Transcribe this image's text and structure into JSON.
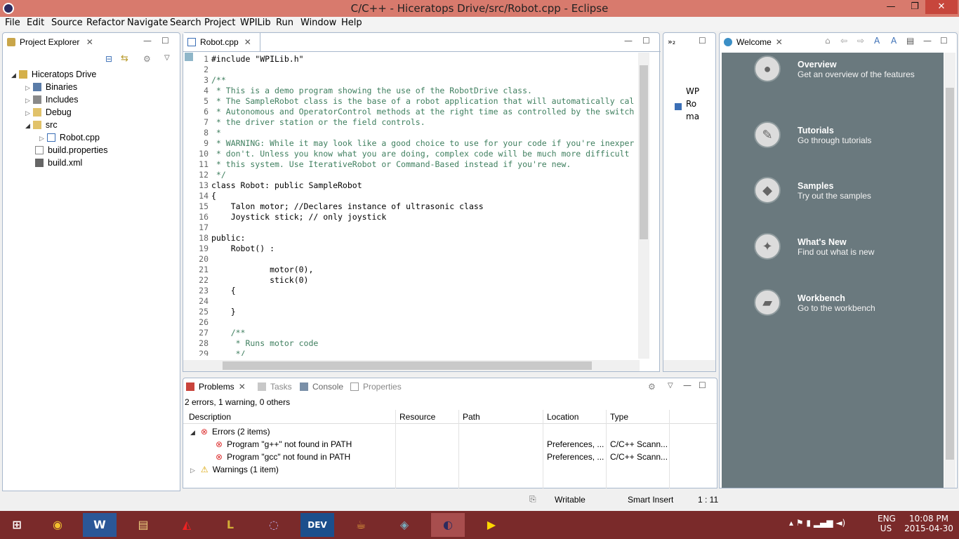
{
  "window": {
    "title": "C/C++ - Hiceratops Drive/src/Robot.cpp - Eclipse",
    "min": "—",
    "max": "❐",
    "close": "✕"
  },
  "menu": [
    "File",
    "Edit",
    "Source",
    "Refactor",
    "Navigate",
    "Search",
    "Project",
    "WPILib",
    "Run",
    "Window",
    "Help"
  ],
  "project_explorer": {
    "tab": "Project Explorer",
    "items": [
      "Hiceratops Drive",
      "Binaries",
      "Includes",
      "Debug",
      "src",
      "Robot.cpp",
      "build.properties",
      "build.xml"
    ]
  },
  "editor": {
    "tab": "Robot.cpp",
    "lines": [
      {
        "n": "1",
        "t": "#include \"WPILib.h\""
      },
      {
        "n": "2",
        "t": ""
      },
      {
        "n": "3",
        "t": "/**"
      },
      {
        "n": "4",
        "t": " * This is a demo program showing the use of the RobotDrive class."
      },
      {
        "n": "5",
        "t": " * The SampleRobot class is the base of a robot application that will automatically cal"
      },
      {
        "n": "6",
        "t": " * Autonomous and OperatorControl methods at the right time as controlled by the switch"
      },
      {
        "n": "7",
        "t": " * the driver station or the field controls."
      },
      {
        "n": "8",
        "t": " *"
      },
      {
        "n": "9",
        "t": " * WARNING: While it may look like a good choice to use for your code if you're inexper"
      },
      {
        "n": "10",
        "t": " * don't. Unless you know what you are doing, complex code will be much more difficult"
      },
      {
        "n": "11",
        "t": " * this system. Use IterativeRobot or Command-Based instead if you're new."
      },
      {
        "n": "12",
        "t": " */"
      },
      {
        "n": "13",
        "t": "class Robot: public SampleRobot"
      },
      {
        "n": "14",
        "t": "{"
      },
      {
        "n": "15",
        "t": "    Talon motor; //Declares instance of ultrasonic class"
      },
      {
        "n": "16",
        "t": "    Joystick stick; // only joystick"
      },
      {
        "n": "17",
        "t": ""
      },
      {
        "n": "18",
        "t": "public:"
      },
      {
        "n": "19",
        "t": "    Robot() :"
      },
      {
        "n": "20",
        "t": ""
      },
      {
        "n": "21",
        "t": "            motor(0),"
      },
      {
        "n": "22",
        "t": "            stick(0)"
      },
      {
        "n": "23",
        "t": "    {"
      },
      {
        "n": "24",
        "t": ""
      },
      {
        "n": "25",
        "t": "    }"
      },
      {
        "n": "26",
        "t": ""
      },
      {
        "n": "27",
        "t": "    /**"
      },
      {
        "n": "28",
        "t": "     * Runs motor code"
      },
      {
        "n": "29",
        "t": "     */"
      }
    ]
  },
  "outline": {
    "items": [
      "WP",
      "Ro",
      "ma"
    ]
  },
  "welcome": {
    "tab": "Welcome",
    "items": [
      {
        "title": "Overview",
        "desc": "Get an overview of the features"
      },
      {
        "title": "Tutorials",
        "desc": "Go through tutorials"
      },
      {
        "title": "Samples",
        "desc": "Try out the samples"
      },
      {
        "title": "What's New",
        "desc": "Find out what is new"
      },
      {
        "title": "Workbench",
        "desc": "Go to the workbench"
      }
    ]
  },
  "problems": {
    "tabs": [
      "Problems",
      "Tasks",
      "Console",
      "Properties"
    ],
    "summary": "2 errors, 1 warning, 0 others",
    "columns": [
      "Description",
      "Resource",
      "Path",
      "Location",
      "Type"
    ],
    "groups": [
      {
        "label": "Errors (2 items)",
        "rows": [
          {
            "desc": "Program \"g++\" not found in PATH",
            "resource": "",
            "path": "",
            "location": "Preferences, ...",
            "type": "C/C++ Scann..."
          },
          {
            "desc": "Program \"gcc\" not found in PATH",
            "resource": "",
            "path": "",
            "location": "Preferences, ...",
            "type": "C/C++ Scann..."
          }
        ]
      },
      {
        "label": "Warnings (1 item)",
        "rows": []
      }
    ]
  },
  "status": {
    "writable": "Writable",
    "insert": "Smart Insert",
    "position": "1 : 11"
  },
  "taskbar": {
    "lang": "ENG",
    "region": "US",
    "time": "10:08 PM",
    "date": "2015-04-30"
  }
}
